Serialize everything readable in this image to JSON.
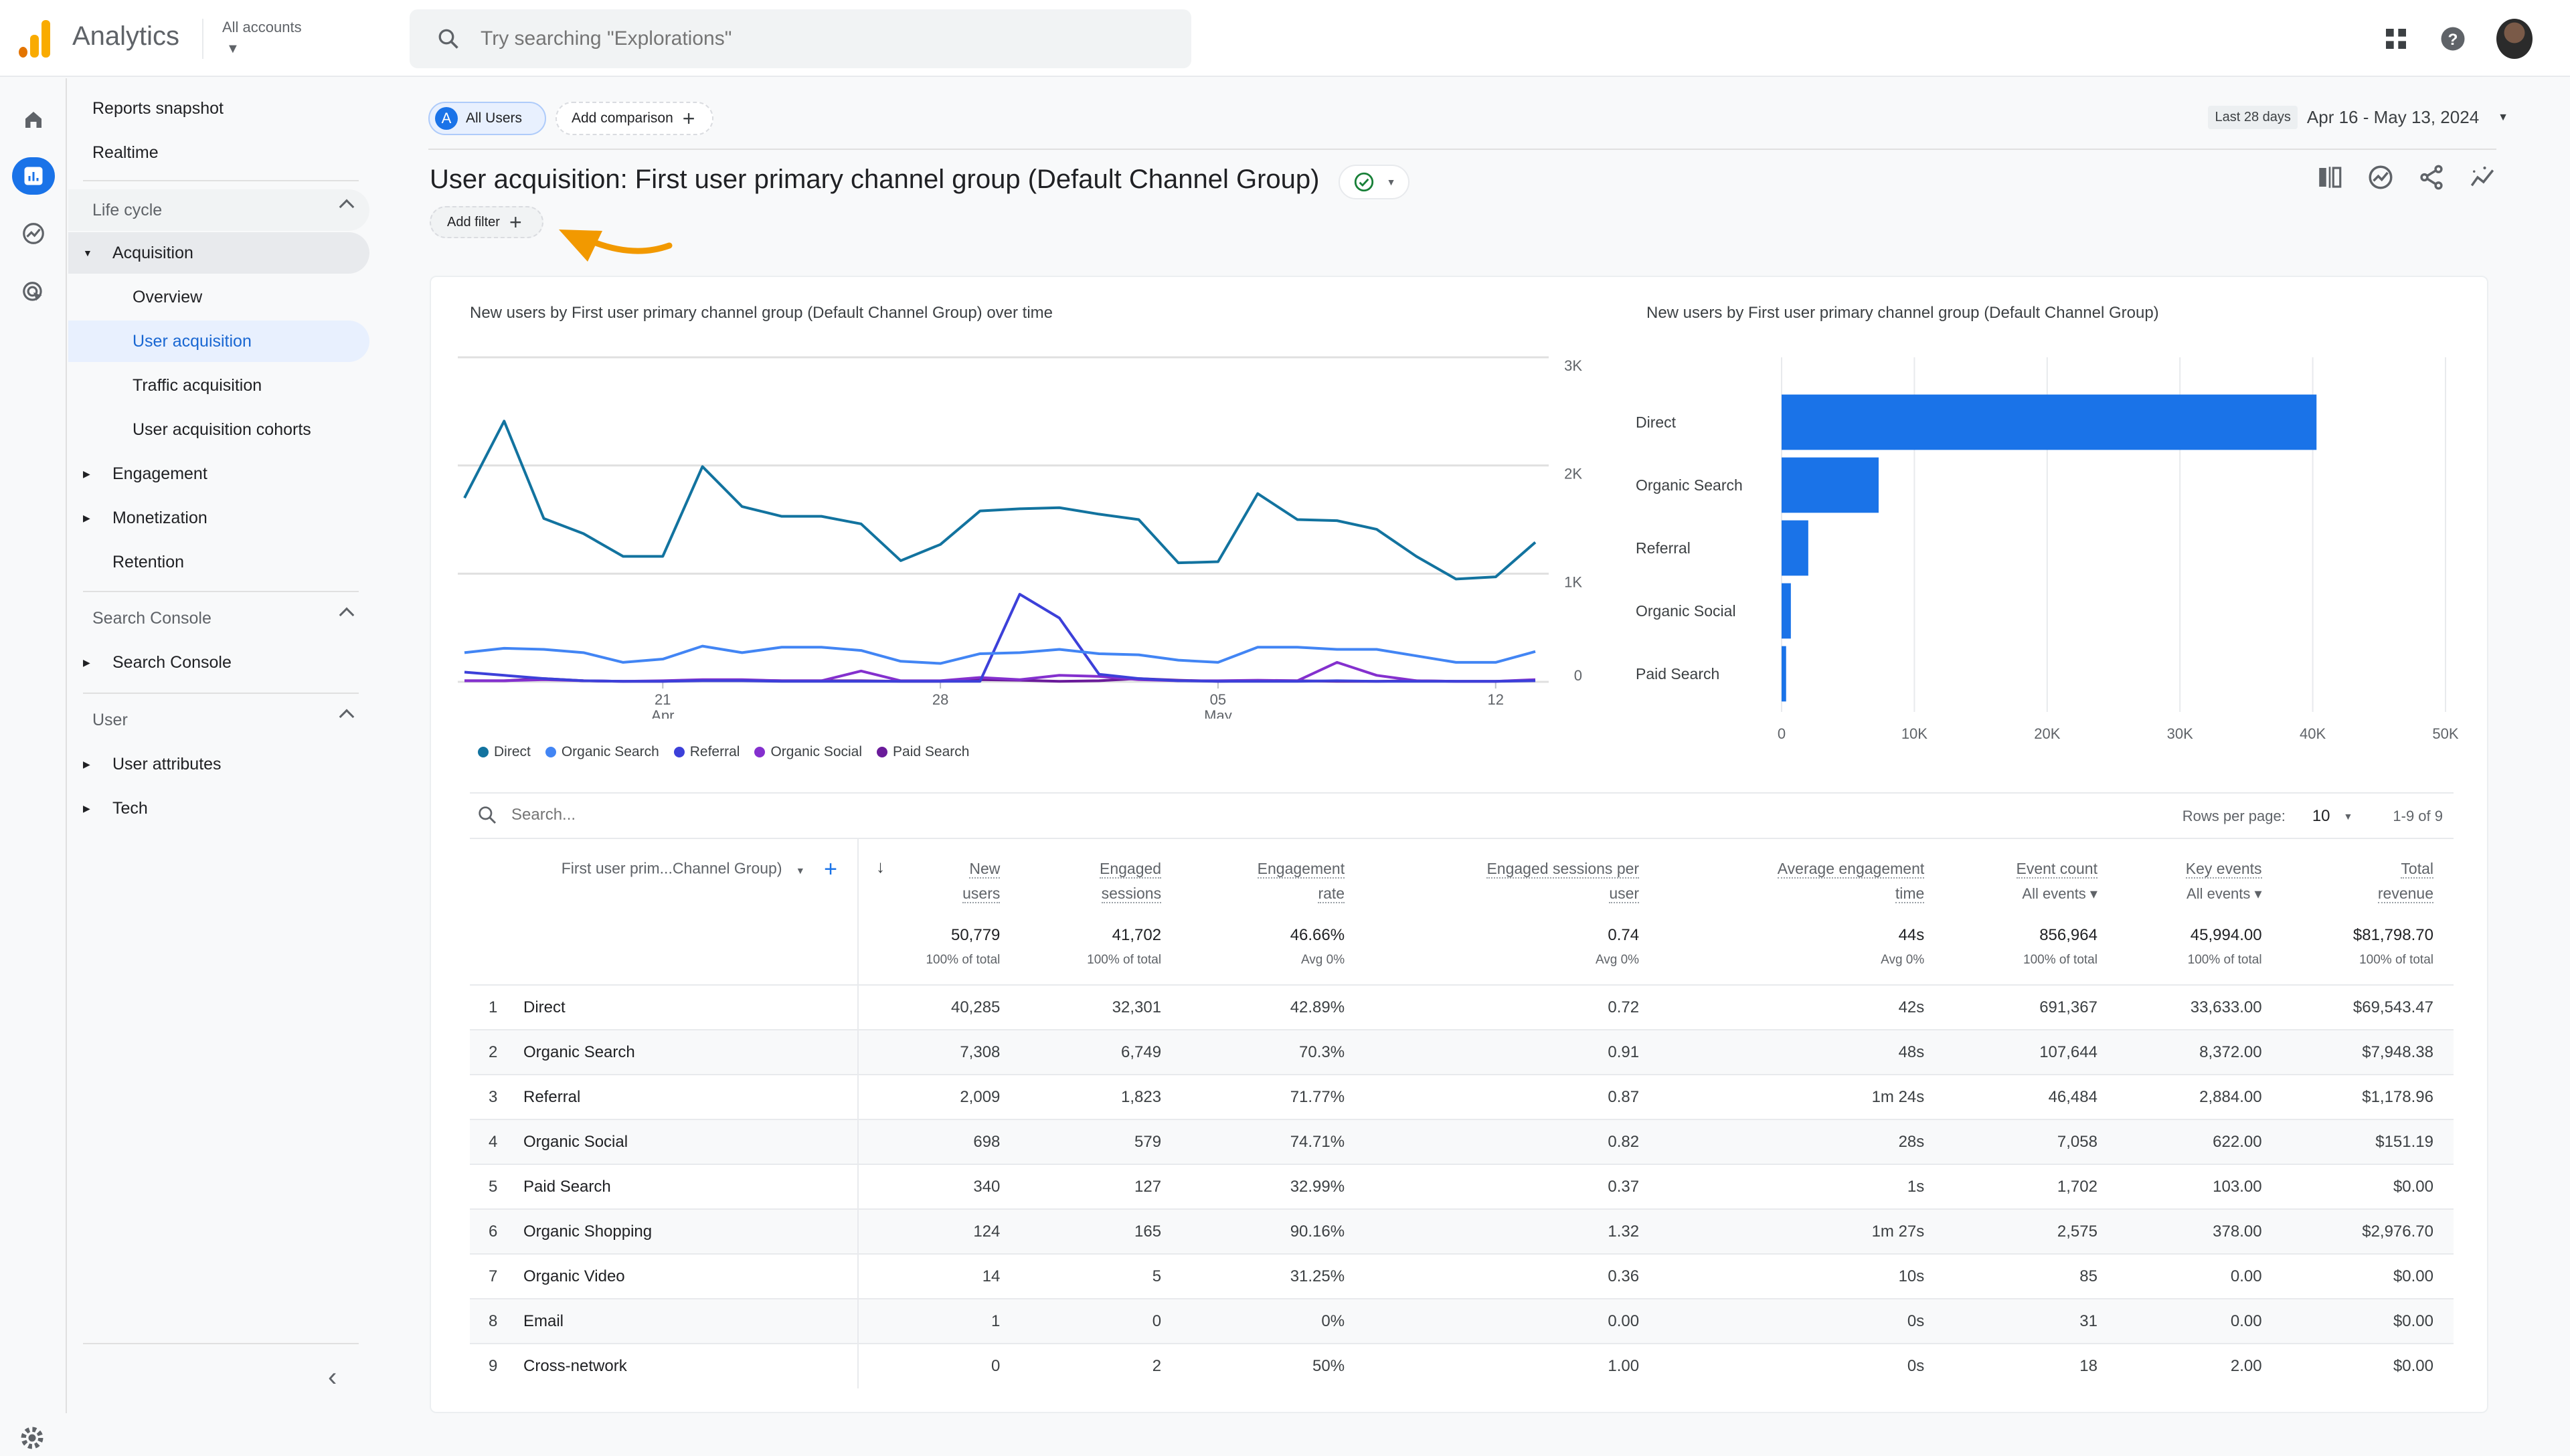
{
  "header": {
    "app_name": "Analytics",
    "account_label": "All accounts",
    "search_placeholder": "Try searching \"Explorations\""
  },
  "sidebar": {
    "items": [
      {
        "label": "Reports snapshot"
      },
      {
        "label": "Realtime"
      },
      {
        "label": "Life cycle"
      },
      {
        "label": "Acquisition"
      },
      {
        "label": "Overview"
      },
      {
        "label": "User acquisition"
      },
      {
        "label": "Traffic acquisition"
      },
      {
        "label": "User acquisition cohorts"
      },
      {
        "label": "Engagement"
      },
      {
        "label": "Monetization"
      },
      {
        "label": "Retention"
      },
      {
        "label": "Search Console"
      },
      {
        "label": "Search Console"
      },
      {
        "label": "User"
      },
      {
        "label": "User attributes"
      },
      {
        "label": "Tech"
      }
    ]
  },
  "toolbar": {
    "segment_badge": "A",
    "segment_label": "All Users",
    "add_comparison": "Add comparison",
    "date_tag": "Last 28 days",
    "date_range": "Apr 16 - May 13, 2024",
    "title": "User acquisition: First user primary channel group (Default Channel Group)",
    "add_filter": "Add filter"
  },
  "colors": {
    "accent": "#1a73e8",
    "annotation_arrow": "#f29900",
    "status_ok": "#188038"
  },
  "chart_data": [
    {
      "type": "line",
      "title": "New users by First user primary channel group (Default Channel Group) over time",
      "x_ticks": [
        {
          "day_index": 5,
          "label": "21",
          "sublabel": "Apr"
        },
        {
          "day_index": 12,
          "label": "28",
          "sublabel": ""
        },
        {
          "day_index": 19,
          "label": "05",
          "sublabel": "May"
        },
        {
          "day_index": 26,
          "label": "12",
          "sublabel": ""
        }
      ],
      "y_ticks": [
        "0",
        "1K",
        "2K",
        "3K"
      ],
      "ylim": [
        0,
        3000
      ],
      "x_count": 28,
      "grid": true,
      "legend_position": "bottom-left",
      "series": [
        {
          "name": "Direct",
          "color": "#12739f",
          "values": [
            1700,
            2410,
            1510,
            1370,
            1160,
            1160,
            1990,
            1620,
            1530,
            1530,
            1460,
            1120,
            1270,
            1580,
            1600,
            1610,
            1550,
            1500,
            1100,
            1110,
            1740,
            1500,
            1490,
            1410,
            1160,
            950,
            970,
            1290
          ]
        },
        {
          "name": "Organic Search",
          "color": "#4285f4",
          "values": [
            270,
            310,
            300,
            270,
            180,
            210,
            330,
            270,
            320,
            320,
            290,
            190,
            170,
            260,
            270,
            300,
            260,
            250,
            200,
            180,
            320,
            320,
            300,
            300,
            240,
            180,
            180,
            280
          ]
        },
        {
          "name": "Referral",
          "color": "#3c40d9",
          "values": [
            90,
            60,
            30,
            10,
            5,
            5,
            10,
            10,
            5,
            5,
            5,
            5,
            5,
            5,
            810,
            590,
            70,
            30,
            10,
            5,
            5,
            5,
            10,
            5,
            5,
            5,
            5,
            10
          ]
        },
        {
          "name": "Organic Social",
          "color": "#8430ce",
          "values": [
            10,
            10,
            20,
            10,
            5,
            10,
            20,
            20,
            10,
            10,
            100,
            10,
            10,
            40,
            20,
            60,
            50,
            20,
            10,
            10,
            15,
            10,
            180,
            60,
            10,
            5,
            5,
            20
          ]
        },
        {
          "name": "Paid Search",
          "color": "#6a1b9a",
          "values": [
            10,
            10,
            30,
            10,
            5,
            5,
            15,
            15,
            10,
            10,
            10,
            5,
            5,
            20,
            15,
            5,
            10,
            30,
            15,
            5,
            10,
            10,
            5,
            5,
            10,
            5,
            5,
            15
          ]
        }
      ]
    },
    {
      "type": "bar",
      "orientation": "horizontal",
      "title": "New users by First user primary channel group (Default Channel Group)",
      "categories": [
        "Direct",
        "Organic Search",
        "Referral",
        "Organic Social",
        "Paid Search"
      ],
      "values": [
        40285,
        7308,
        2009,
        698,
        340
      ],
      "x_ticks": [
        "0",
        "10K",
        "20K",
        "30K",
        "40K",
        "50K"
      ],
      "xlim": [
        0,
        50000
      ],
      "color": "#1a73e8",
      "grid": true
    }
  ],
  "table": {
    "search_placeholder": "Search...",
    "rows_per_page_label": "Rows per page:",
    "rows_per_page": "10",
    "range_label": "1-9 of 9",
    "dimension_header": "First user prim...Channel Group)",
    "columns": [
      {
        "line1": "New",
        "line2": "users",
        "sub": ""
      },
      {
        "line1": "Engaged",
        "line2": "sessions",
        "sub": ""
      },
      {
        "line1": "Engagement",
        "line2": "rate",
        "sub": ""
      },
      {
        "line1": "Engaged sessions per",
        "line2": "user",
        "sub": ""
      },
      {
        "line1": "Average engagement",
        "line2": "time",
        "sub": ""
      },
      {
        "line1": "Event count",
        "line2": "",
        "sub": "All events"
      },
      {
        "line1": "Key events",
        "line2": "",
        "sub": "All events"
      },
      {
        "line1": "Total",
        "line2": "revenue",
        "sub": ""
      }
    ],
    "totals": [
      {
        "value": "50,779",
        "sub": "100% of total"
      },
      {
        "value": "41,702",
        "sub": "100% of total"
      },
      {
        "value": "46.66%",
        "sub": "Avg 0%"
      },
      {
        "value": "0.74",
        "sub": "Avg 0%"
      },
      {
        "value": "44s",
        "sub": "Avg 0%"
      },
      {
        "value": "856,964",
        "sub": "100% of total"
      },
      {
        "value": "45,994.00",
        "sub": "100% of total"
      },
      {
        "value": "$81,798.70",
        "sub": "100% of total"
      }
    ],
    "rows": [
      {
        "idx": "1",
        "name": "Direct",
        "cells": [
          "40,285",
          "32,301",
          "42.89%",
          "0.72",
          "42s",
          "691,367",
          "33,633.00",
          "$69,543.47"
        ]
      },
      {
        "idx": "2",
        "name": "Organic Search",
        "cells": [
          "7,308",
          "6,749",
          "70.3%",
          "0.91",
          "48s",
          "107,644",
          "8,372.00",
          "$7,948.38"
        ]
      },
      {
        "idx": "3",
        "name": "Referral",
        "cells": [
          "2,009",
          "1,823",
          "71.77%",
          "0.87",
          "1m 24s",
          "46,484",
          "2,884.00",
          "$1,178.96"
        ]
      },
      {
        "idx": "4",
        "name": "Organic Social",
        "cells": [
          "698",
          "579",
          "74.71%",
          "0.82",
          "28s",
          "7,058",
          "622.00",
          "$151.19"
        ]
      },
      {
        "idx": "5",
        "name": "Paid Search",
        "cells": [
          "340",
          "127",
          "32.99%",
          "0.37",
          "1s",
          "1,702",
          "103.00",
          "$0.00"
        ]
      },
      {
        "idx": "6",
        "name": "Organic Shopping",
        "cells": [
          "124",
          "165",
          "90.16%",
          "1.32",
          "1m 27s",
          "2,575",
          "378.00",
          "$2,976.70"
        ]
      },
      {
        "idx": "7",
        "name": "Organic Video",
        "cells": [
          "14",
          "5",
          "31.25%",
          "0.36",
          "10s",
          "85",
          "0.00",
          "$0.00"
        ]
      },
      {
        "idx": "8",
        "name": "Email",
        "cells": [
          "1",
          "0",
          "0%",
          "0.00",
          "0s",
          "31",
          "0.00",
          "$0.00"
        ]
      },
      {
        "idx": "9",
        "name": "Cross-network",
        "cells": [
          "0",
          "2",
          "50%",
          "1.00",
          "0s",
          "18",
          "2.00",
          "$0.00"
        ]
      }
    ]
  }
}
